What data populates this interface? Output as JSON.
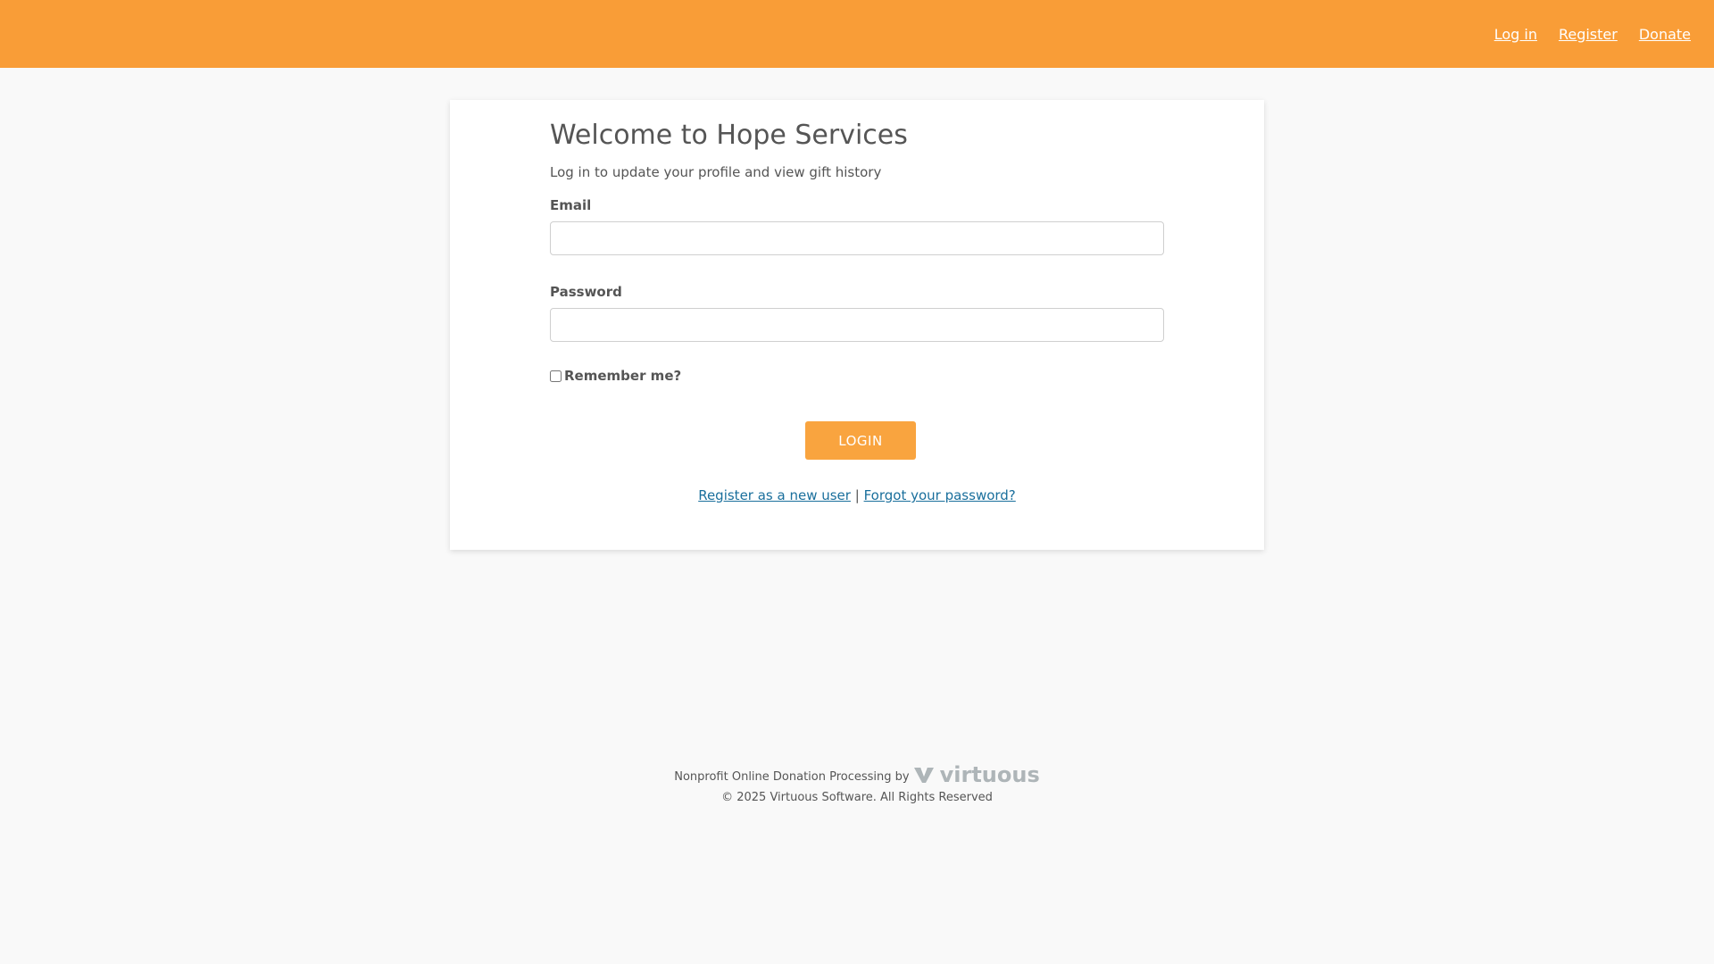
{
  "header": {
    "nav": {
      "login": "Log in",
      "register": "Register",
      "donate": "Donate"
    }
  },
  "login_card": {
    "title": "Welcome to Hope Services",
    "subtitle": "Log in to update your profile and view gift history",
    "email_label": "Email",
    "email_value": "",
    "password_label": "Password",
    "password_value": "",
    "remember_label": "Remember me?",
    "remember_checked": false,
    "login_button": "LOGIN",
    "register_link": "Register as a new user",
    "separator": "|",
    "forgot_link": "Forgot your password?"
  },
  "footer": {
    "processing_text": "Nonprofit Online Donation Processing by",
    "brand_name": "virtuous",
    "copyright": "© 2025 Virtuous Software. All Rights Reserved"
  },
  "colors": {
    "header_bg": "#f99d37",
    "button_bg": "#f9a43f",
    "link": "#1a6f9c",
    "page_bg": "#f9f9f9"
  }
}
